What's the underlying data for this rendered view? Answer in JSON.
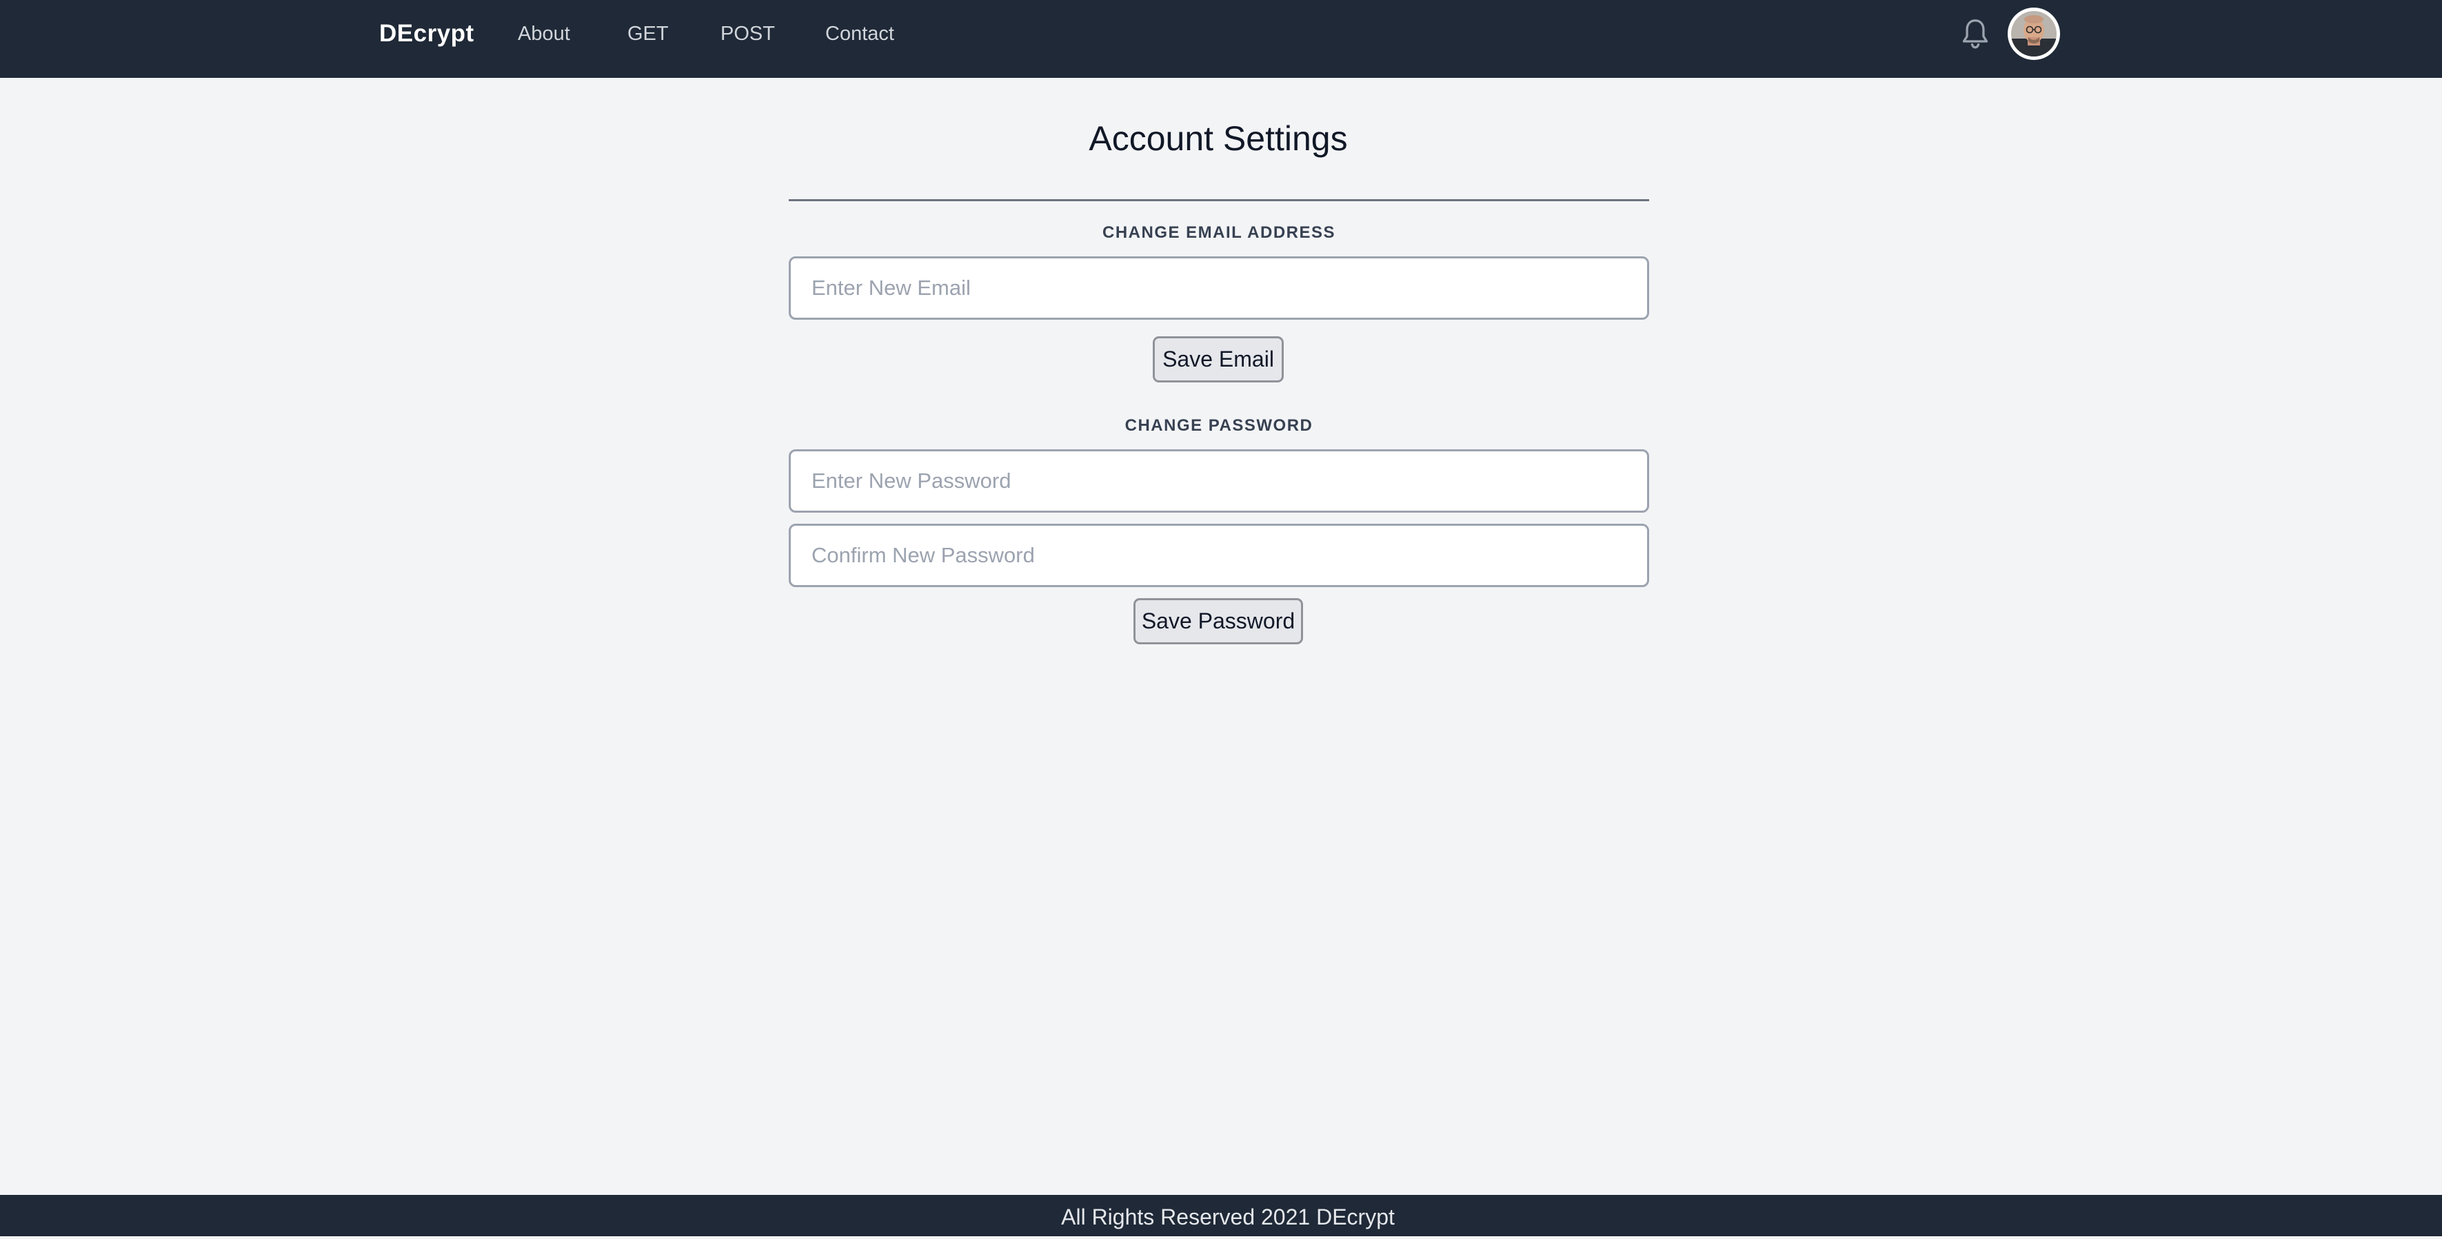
{
  "navbar": {
    "brand": "DEcrypt",
    "links": [
      "About",
      "GET",
      "POST",
      "Contact"
    ],
    "notification_icon": "bell-icon",
    "avatar_icon": "user-avatar"
  },
  "main": {
    "title": "Account Settings",
    "email_section": {
      "label": "CHANGE EMAIL ADDRESS",
      "input_placeholder": "Enter New Email",
      "input_value": "",
      "button_label": "Save Email"
    },
    "password_section": {
      "label": "CHANGE PASSWORD",
      "new_password_placeholder": "Enter New Password",
      "confirm_password_placeholder": "Confirm New Password",
      "button_label": "Save Password"
    }
  },
  "footer": {
    "text": "All Rights Reserved 2021 DEcrypt"
  },
  "colors": {
    "navbar_bg": "#1f2937",
    "page_bg": "#f3f4f6",
    "nav_link": "#d1d5db",
    "input_border": "#9ca3af",
    "button_bg": "#e5e7eb"
  }
}
